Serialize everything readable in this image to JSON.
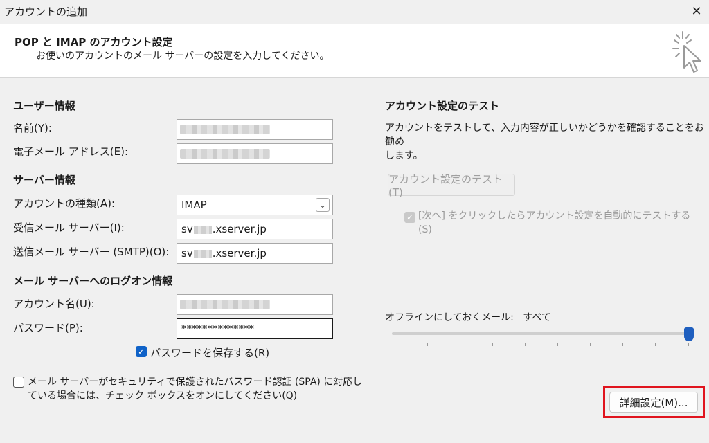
{
  "window": {
    "title": "アカウントの追加",
    "close": "✕"
  },
  "header": {
    "title": "POP と IMAP のアカウント設定",
    "subtitle": "お使いのアカウントのメール サーバーの設定を入力してください。",
    "icon": "cursor-sparkle-icon"
  },
  "user_info": {
    "title": "ユーザー情報",
    "name_label": "名前(Y):",
    "email_label": "電子メール アドレス(E):"
  },
  "server_info": {
    "title": "サーバー情報",
    "account_type_label": "アカウントの種類(A):",
    "account_type_value": "IMAP",
    "incoming_label": "受信メール サーバー(I):",
    "incoming_prefix": "sv",
    "incoming_suffix": ".xserver.jp",
    "outgoing_label": "送信メール サーバー (SMTP)(O):",
    "outgoing_prefix": "sv",
    "outgoing_suffix": ".xserver.jp"
  },
  "logon_info": {
    "title": "メール サーバーへのログオン情報",
    "account_name_label": "アカウント名(U):",
    "password_label": "パスワード(P):",
    "password_value": "**************",
    "save_password_label": "パスワードを保存する(R)",
    "spa_label_line1": "メール サーバーがセキュリティで保護されたパスワード認証 (SPA) に対応し",
    "spa_label_line2": "ている場合には、チェック ボックスをオンにしてください(Q)"
  },
  "test": {
    "title": "アカウント設定のテスト",
    "description_line1": "アカウントをテストして、入力内容が正しいかどうかを確認することをお勧め",
    "description_line2": "します。",
    "test_button": "アカウント設定のテスト(T)",
    "auto_test_line1": "[次へ] をクリックしたらアカウント設定を自動的にテストする",
    "auto_test_line2": "(S)"
  },
  "offline": {
    "label": "オフラインにしておくメール:",
    "value": "すべて",
    "slider_level": 1.0
  },
  "advanced_button": "詳細設定(M)...",
  "colors": {
    "accent": "#1f5fbf",
    "highlight": "#e0141e"
  }
}
